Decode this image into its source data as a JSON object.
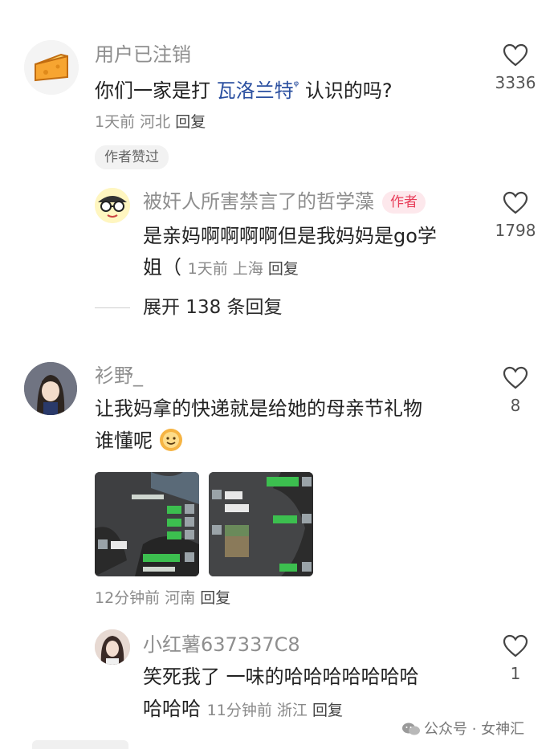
{
  "comments": [
    {
      "username": "用户已注销",
      "text_before": "你们一家是打 ",
      "link": "瓦洛兰特",
      "link_suffix": "ᵠ",
      "text_after": " 认识的吗?",
      "time": "1天前",
      "location": "河北",
      "reply_label": "回复",
      "likes": "3336",
      "chip": "作者赞过",
      "avatar_icon": "cheese-icon",
      "replies": [
        {
          "username": "被奸人所害禁言了的哲学藻",
          "author_tag": "作者",
          "text_line1": "是亲妈啊啊啊啊但是我妈妈是go学",
          "text_line2": "姐（",
          "time": "1天前",
          "location": "上海",
          "reply_label": "回复",
          "likes": "1798"
        }
      ],
      "expand_label": "展开 138 条回复"
    },
    {
      "username": "衫野_",
      "text_line1": "让我妈拿的快递就是给她的母亲节礼物",
      "text_line2": "谁懂呢",
      "emoji": "smile-sun-icon",
      "time": "12分钟前",
      "location": "河南",
      "reply_label": "回复",
      "likes": "8",
      "replies": [
        {
          "username": "小红薯637337C8",
          "text_line1": "笑死我了 一味的哈哈哈哈哈哈哈",
          "text_line2": "哈哈哈",
          "time": "11分钟前",
          "location": "浙江",
          "reply_label": "回复",
          "likes": "1"
        }
      ]
    }
  ],
  "watermark": "公众号 · 女神汇",
  "colors": {
    "author_tag_bg": "#fde8ec",
    "author_tag_text": "#e83e5a",
    "link": "#2a4fa0",
    "chat_green": "#3cbf4f"
  }
}
